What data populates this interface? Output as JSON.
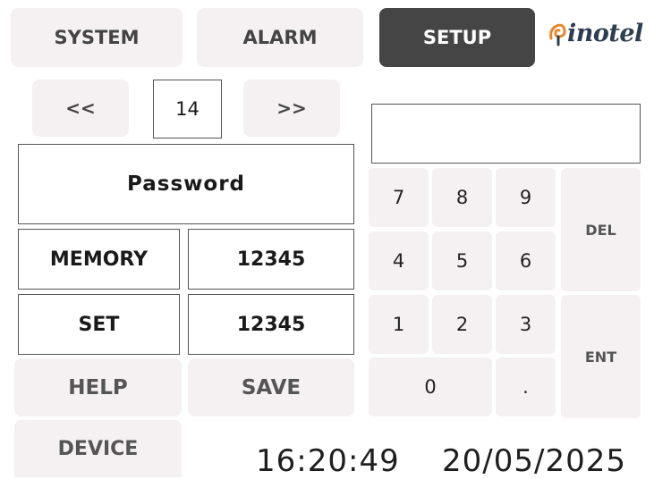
{
  "tabs": [
    {
      "label": "SYSTEM",
      "active": false
    },
    {
      "label": "ALARM",
      "active": false
    },
    {
      "label": "SETUP",
      "active": true
    }
  ],
  "brand": {
    "logo_text": "inotel",
    "icon": "inotel-swirl-icon",
    "accent": "#e8862a"
  },
  "pager": {
    "prev_label": "<<",
    "page": "14",
    "next_label": ">>"
  },
  "panel": {
    "title": "Password",
    "rows": [
      {
        "label": "MEMORY",
        "value": "12345"
      },
      {
        "label": "SET",
        "value": "12345"
      }
    ]
  },
  "actions": {
    "help": "HELP",
    "save": "SAVE",
    "device": "DEVICE"
  },
  "keypad": {
    "display": "",
    "keys": {
      "k7": "7",
      "k8": "8",
      "k9": "9",
      "k4": "4",
      "k5": "5",
      "k6": "6",
      "k1": "1",
      "k2": "2",
      "k3": "3",
      "k0": "0",
      "dot": "."
    },
    "del": "DEL",
    "ent": "ENT"
  },
  "status": {
    "time": "16:20:49",
    "date": "20/05/2025"
  },
  "colors": {
    "active_tab": "#454545",
    "button_bg": "#f5f1f2",
    "border": "#555555"
  }
}
